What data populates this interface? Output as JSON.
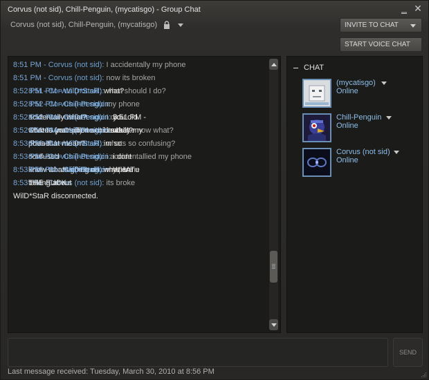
{
  "window": {
    "title": "Corvus (not sid), Chill-Penguin, (mycatisgo) - Group Chat",
    "participants": "Corvus (not sid), Chill-Penguin, (mycatisgo)",
    "minimize_glyph": "‗",
    "close_glyph": "✕"
  },
  "toolbar": {
    "invite_label": "INVITE TO CHAT",
    "voice_label": "START VOICE CHAT"
  },
  "messages": [
    {
      "kind": "self",
      "time": "8:51 PM",
      "sender": "Corvus (not sid)",
      "text": "I accidentally my phone"
    },
    {
      "kind": "self",
      "time": "8:51 PM",
      "sender": "Corvus (not sid)",
      "text": "now its broken"
    },
    {
      "kind": "friend",
      "time": "8:51 PM",
      "sender": "WilD*StaR",
      "text": "what?"
    },
    {
      "kind": "self",
      "time": "8:52 PM",
      "sender": "Corvus (not sid)",
      "text": "what should I do?"
    },
    {
      "kind": "friend",
      "time": "8:52 PM",
      "sender": "Chill-Penguin",
      "text": "acidentally what?"
    },
    {
      "kind": "self",
      "time": "8:52 PM",
      "sender": "Corvus (not sid)",
      "text": "my phone"
    },
    {
      "kind": "friend",
      "time": "8:52 PM",
      "sender": "Chill-Penguin",
      "text": "you did what to your phone to break it?"
    },
    {
      "kind": "friend",
      "time": "8:52 PM",
      "sender": "Chill-Penguin",
      "text": "8:51 PM - Corvus (not sid): I accidentally my",
      "wrap": "phone"
    },
    {
      "kind": "self",
      "time": "8:52 PM",
      "sender": "Corvus (not sid)",
      "text": "I did"
    },
    {
      "kind": "friend",
      "time": "8:52 PM",
      "sender": "Chill-Penguin",
      "text": "what does that mean?"
    },
    {
      "kind": "self",
      "time": "8:52 PM",
      "sender": "Corvus (not sid)",
      "text": "its broke now what?"
    },
    {
      "kind": "friend",
      "time": "8:53 PM",
      "sender": "WilD*StaR",
      "text": "im so confused"
    },
    {
      "kind": "self",
      "time": "8:53 PM",
      "sender": "Corvus (not sid)",
      "text": "whats so confusing?"
    },
    {
      "kind": "friend",
      "time": "8:53 PM",
      "sender": "Chill-Penguin",
      "text": "i dont know whats going on"
    },
    {
      "kind": "self",
      "time": "8:53 PM",
      "sender": "Corvus (not sid)",
      "text": "i accidentallied my phone"
    },
    {
      "kind": "friend",
      "time": "8:53 PM",
      "sender": "Chill-Penguin",
      "text": "WHAT THE FUCK"
    },
    {
      "kind": "friend",
      "time": "8:53 PM",
      "sender": "WilD*StaR",
      "text": "what are u talking about"
    },
    {
      "kind": "self",
      "time": "8:53 PM",
      "sender": "Corvus (not sid)",
      "text": "my phone"
    },
    {
      "kind": "self",
      "time": "8:53 PM",
      "sender": "Corvus (not sid)",
      "text": "its broke"
    },
    {
      "kind": "sys",
      "text": "WilD*StaR disconnected."
    }
  ],
  "friends_panel": {
    "header": "CHAT",
    "members": [
      {
        "name": "(mycatisgo)",
        "status": "Online",
        "avatar_icon": "robot-avatar"
      },
      {
        "name": "Chill-Penguin",
        "status": "Online",
        "avatar_icon": "penguin-avatar"
      },
      {
        "name": "Corvus (not sid)",
        "status": "Online",
        "avatar_icon": "dark-swirl-avatar"
      }
    ]
  },
  "compose": {
    "send_label": "SEND"
  },
  "status": {
    "last_message": "Last message received: Tuesday, March 30, 2010 at 8:56 PM"
  },
  "colors": {
    "timestamp_blue": "#7aa6d6",
    "friend_text": "#e2e2e2",
    "self_text": "#a6a6a6",
    "online_blue": "#8ebee8"
  }
}
